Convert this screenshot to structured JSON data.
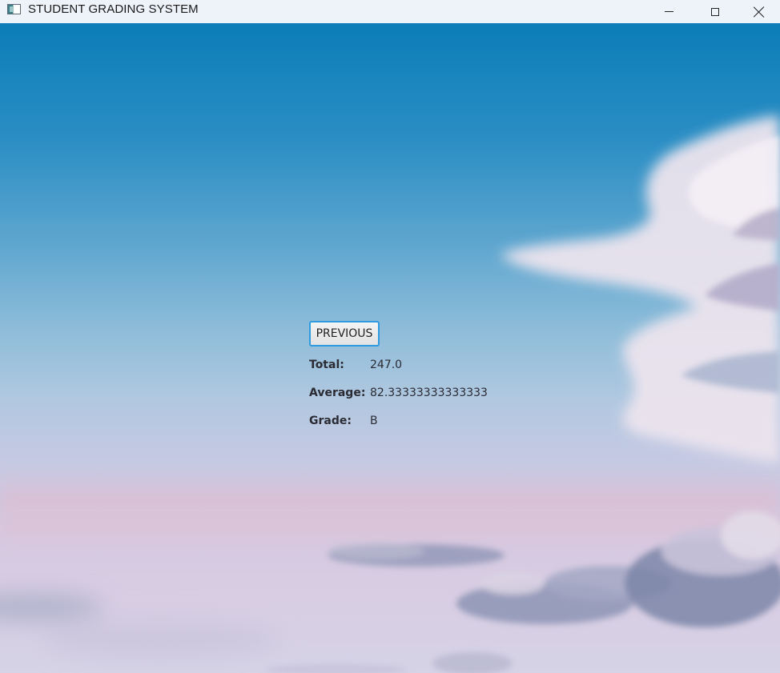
{
  "window": {
    "title": "STUDENT GRADING SYSTEM",
    "icon": "java-app-icon",
    "controls": [
      "minimize-icon",
      "maximize-icon",
      "close-icon"
    ]
  },
  "form": {
    "previous_label": "PREVIOUS",
    "total_label": "Total:",
    "total_value": "247.0",
    "average_label": "Average:",
    "average_value": "82.33333333333333",
    "grade_label": "Grade:",
    "grade_value": "B"
  },
  "colors": {
    "button_focus_border": "#2f9be0",
    "titlebar_bg": "#eef2f9",
    "label_text": "#2b2b33"
  }
}
